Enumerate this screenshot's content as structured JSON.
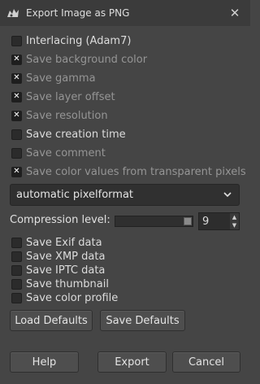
{
  "window": {
    "title": "Export Image as PNG",
    "close_icon": "close-icon"
  },
  "options": [
    {
      "label": "Interlacing (Adam7)",
      "checked": false,
      "enabled": true
    },
    {
      "label": "Save background color",
      "checked": true,
      "enabled": false
    },
    {
      "label": "Save gamma",
      "checked": true,
      "enabled": false
    },
    {
      "label": "Save layer offset",
      "checked": true,
      "enabled": false
    },
    {
      "label": "Save resolution",
      "checked": true,
      "enabled": false
    },
    {
      "label": "Save creation time",
      "checked": false,
      "enabled": true
    },
    {
      "label": "Save comment",
      "checked": false,
      "enabled": false
    },
    {
      "label": "Save color values from transparent pixels",
      "checked": true,
      "enabled": false
    }
  ],
  "format": {
    "selected": "automatic pixelformat"
  },
  "compression": {
    "label": "Compression level:",
    "value": "9",
    "level_fraction": 1.0
  },
  "metadata": [
    {
      "label": "Save Exif data",
      "checked": false
    },
    {
      "label": "Save XMP data",
      "checked": false
    },
    {
      "label": "Save IPTC data",
      "checked": false
    },
    {
      "label": "Save thumbnail",
      "checked": false
    },
    {
      "label": "Save color profile",
      "checked": false
    }
  ],
  "buttons": {
    "load_defaults": "Load Defaults",
    "save_defaults": "Save Defaults",
    "help": "Help",
    "export": "Export",
    "cancel": "Cancel"
  },
  "colors": {
    "background": "#454545",
    "titlebar": "#3b3b3b",
    "field": "#303030"
  }
}
